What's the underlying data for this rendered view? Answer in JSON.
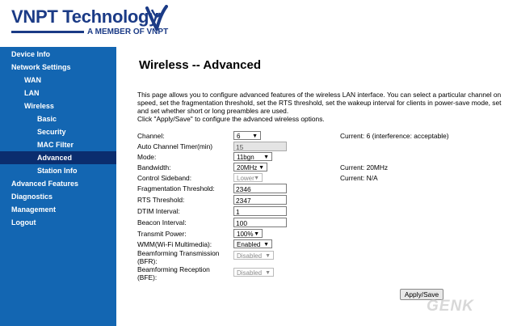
{
  "brand": {
    "name": "VNPT Technology",
    "tagline": "A MEMBER OF VNPT",
    "primary_color": "#1b3b86"
  },
  "sidebar": {
    "bg_color": "#1366b2",
    "active_color": "#0b2d6e",
    "items": [
      {
        "label": "Device Info"
      },
      {
        "label": "Network Settings"
      },
      {
        "label": "WAN"
      },
      {
        "label": "LAN"
      },
      {
        "label": "Wireless"
      },
      {
        "label": "Basic"
      },
      {
        "label": "Security"
      },
      {
        "label": "MAC Filter"
      },
      {
        "label": "Advanced"
      },
      {
        "label": "Station Info"
      },
      {
        "label": "Advanced Features"
      },
      {
        "label": "Diagnostics"
      },
      {
        "label": "Management"
      },
      {
        "label": "Logout"
      }
    ],
    "active": "Advanced"
  },
  "page": {
    "title": "Wireless -- Advanced",
    "description_lines": [
      "This page allows you to configure advanced features of the wireless LAN interface. You can select a particular channel on",
      "speed, set the fragmentation threshold, set the RTS threshold, set the wakeup interval for clients in power-save mode, set",
      "and set whether short or long preambles are used.",
      "Click \"Apply/Save\" to configure the advanced wireless options."
    ]
  },
  "form": {
    "channel": {
      "label": "Channel:",
      "value": "6",
      "current": "Current: 6 (interference: acceptable)"
    },
    "auto_channel_timer": {
      "label": "Auto Channel Timer(min)",
      "value": "15"
    },
    "mode": {
      "label": "Mode:",
      "value": "11bgn"
    },
    "bandwidth": {
      "label": "Bandwidth:",
      "value": "20MHz",
      "current": "Current: 20MHz"
    },
    "control_sideband": {
      "label": "Control Sideband:",
      "value": "Lower",
      "current": "Current: N/A"
    },
    "fragmentation_threshold": {
      "label": "Fragmentation Threshold:",
      "value": "2346"
    },
    "rts_threshold": {
      "label": "RTS Threshold:",
      "value": "2347"
    },
    "dtim_interval": {
      "label": "DTIM Interval:",
      "value": "1"
    },
    "beacon_interval": {
      "label": "Beacon Interval:",
      "value": "100"
    },
    "transmit_power": {
      "label": "Transmit Power:",
      "value": "100%"
    },
    "wmm": {
      "label": "WMM(Wi-Fi Multimedia):",
      "value": "Enabled"
    },
    "bfr": {
      "label_line1": "Beamforming Transmission",
      "label_line2": "(BFR):",
      "value": "Disabled"
    },
    "bfe": {
      "label_line1": "Beamforming Reception",
      "label_line2": "(BFE):",
      "value": "Disabled"
    },
    "apply_label": "Apply/Save"
  },
  "watermark": "GENK",
  "icons": {
    "dropdown": "chevron-down-icon",
    "logo": "vnpt-logo-icon"
  }
}
